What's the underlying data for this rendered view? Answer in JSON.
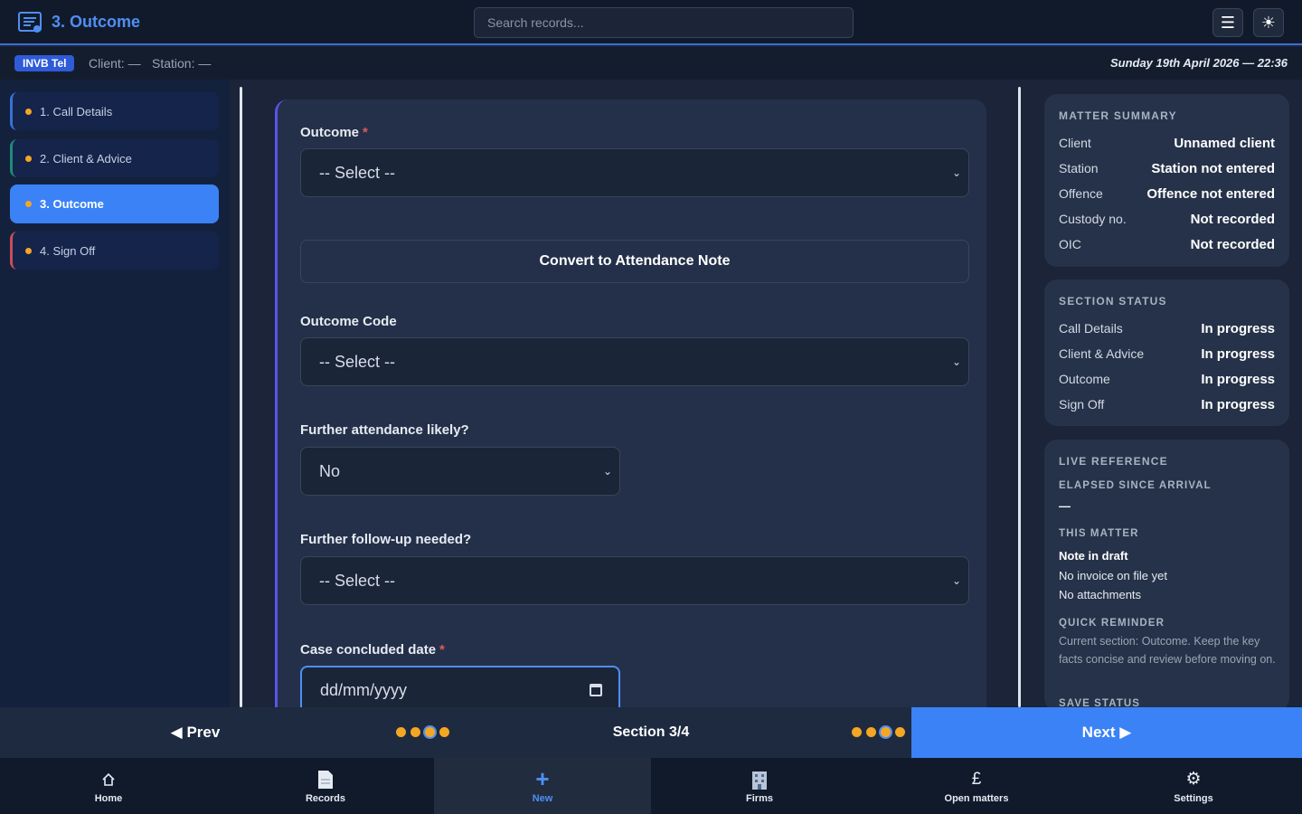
{
  "header": {
    "title": "3. Outcome",
    "search_placeholder": "Search records...",
    "menu_icon": "hamburger-icon",
    "theme_icon": "sun-icon"
  },
  "subbar": {
    "badge": "INVB Tel",
    "client": "Client: —",
    "station": "Station: —",
    "datetime": "Sunday 19th April 2026 — 22:36"
  },
  "nav": {
    "items": [
      {
        "label": "1. Call Details"
      },
      {
        "label": "2. Client & Advice"
      },
      {
        "label": "3. Outcome"
      },
      {
        "label": "4. Sign Off"
      }
    ]
  },
  "form": {
    "outcome_label": "Outcome",
    "outcome_value": "-- Select --",
    "convert_label": "Convert to Attendance Note",
    "outcome_code_label": "Outcome Code",
    "outcome_code_value": "-- Select --",
    "further_attendance_label": "Further attendance likely?",
    "further_attendance_value": "No",
    "followup_label": "Further follow-up needed?",
    "followup_value": "-- Select --",
    "concluded_label": "Case concluded date",
    "concluded_placeholder": "dd/mm/yyyy",
    "required_mark": "*"
  },
  "summary": {
    "title": "MATTER SUMMARY",
    "rows": [
      {
        "k": "Client",
        "v": "Unnamed client"
      },
      {
        "k": "Station",
        "v": "Station not entered"
      },
      {
        "k": "Offence",
        "v": "Offence not entered"
      },
      {
        "k": "Custody no.",
        "v": "Not recorded"
      },
      {
        "k": "OIC",
        "v": "Not recorded"
      }
    ]
  },
  "status": {
    "title": "SECTION STATUS",
    "rows": [
      {
        "k": "Call Details",
        "v": "In progress"
      },
      {
        "k": "Client & Advice",
        "v": "In progress"
      },
      {
        "k": "Outcome",
        "v": "In progress"
      },
      {
        "k": "Sign Off",
        "v": "In progress"
      }
    ]
  },
  "live": {
    "title": "LIVE REFERENCE",
    "elapsed_title": "ELAPSED SINCE ARRIVAL",
    "elapsed_value": "—",
    "matter_title": "THIS MATTER",
    "matter_lines": [
      "Note in draft",
      "No invoice on file yet",
      "No attachments"
    ],
    "reminder_title": "QUICK REMINDER",
    "reminder_text": "Current section: Outcome. Keep the key facts concise and review before moving on.",
    "save_title": "SAVE STATUS"
  },
  "sectionbar": {
    "prev": "◀ Prev",
    "section": "Section 3/4",
    "next": "Next ▶"
  },
  "bottomnav": {
    "items": [
      {
        "label": "Home",
        "icon": "home-icon"
      },
      {
        "label": "Records",
        "icon": "document-icon"
      },
      {
        "label": "New",
        "icon": "plus-icon"
      },
      {
        "label": "Firms",
        "icon": "building-icon"
      },
      {
        "label": "Open matters",
        "icon": "pound-icon"
      },
      {
        "label": "Settings",
        "icon": "gear-icon"
      }
    ]
  }
}
